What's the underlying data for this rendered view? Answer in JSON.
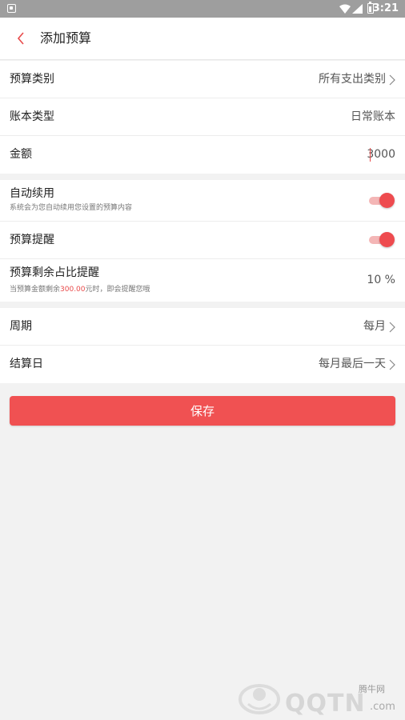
{
  "status_bar": {
    "time": "3:21"
  },
  "header": {
    "title": "添加预算"
  },
  "group1": {
    "budget_category": {
      "label": "预算类别",
      "value": "所有支出类别"
    },
    "account_type": {
      "label": "账本类型",
      "value": "日常账本"
    },
    "amount": {
      "label": "金额",
      "value": "3000"
    }
  },
  "group2": {
    "auto_renew": {
      "label": "自动续用",
      "sub": "系统会为您自动续用您设置的预算内容",
      "on": true
    },
    "budget_reminder": {
      "label": "预算提醒",
      "on": true
    },
    "remaining_reminder": {
      "label": "预算剩余占比提醒",
      "sub_prefix": "当预算金额剩余",
      "sub_amount": "300.00",
      "sub_suffix": "元时，即会提醒您哦",
      "value": "10 %"
    }
  },
  "group3": {
    "period": {
      "label": "周期",
      "value": "每月"
    },
    "settlement_day": {
      "label": "结算日",
      "value": "每月最后一天"
    }
  },
  "save_label": "保存",
  "watermark": {
    "top": "腾牛网",
    "main": "QQTN",
    "suffix": ".com"
  },
  "colors": {
    "accent": "#f05152",
    "status_bar": "#9e9e9e"
  }
}
